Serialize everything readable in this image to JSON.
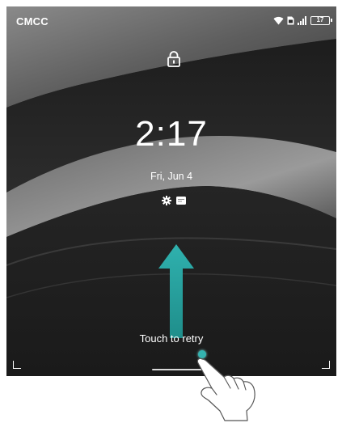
{
  "status_bar": {
    "carrier": "CMCC",
    "battery_level": "17",
    "icons": [
      "wifi-icon",
      "sim-card-icon",
      "signal-icon",
      "battery-icon"
    ]
  },
  "lock_screen": {
    "lock_icon": "lock-icon",
    "time": "2:17",
    "date": "Fri, Jun 4",
    "shortcut_icons": [
      "settings-gear-icon",
      "message-card-icon"
    ],
    "swipe_hint_icon": "arrow-up-icon",
    "retry_text": "Touch to retry"
  },
  "overlay": {
    "gesture_icon": "pointing-hand-icon",
    "touch_indicator": "touch-dot"
  },
  "colors": {
    "accent": "#2aa6a3",
    "background": "#2a2a2a",
    "text": "#ffffff"
  }
}
